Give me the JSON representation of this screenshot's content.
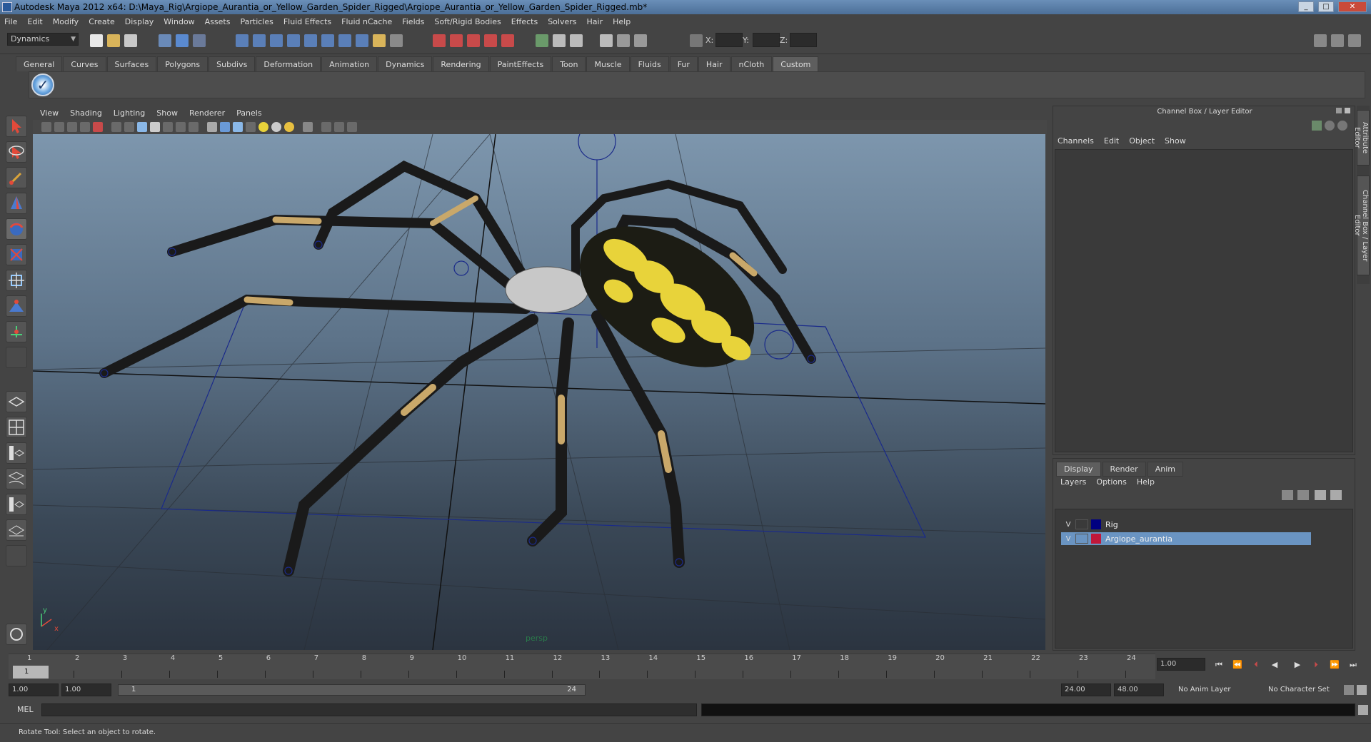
{
  "window": {
    "title": "Autodesk Maya 2012 x64: D:\\Maya_Rig\\Argiope_Aurantia_or_Yellow_Garden_Spider_Rigged\\Argiope_Aurantia_or_Yellow_Garden_Spider_Rigged.mb*",
    "minimize": "_",
    "maximize": "□",
    "close": "✕"
  },
  "menubar": [
    "File",
    "Edit",
    "Modify",
    "Create",
    "Display",
    "Window",
    "Assets",
    "Particles",
    "Fluid Effects",
    "Fluid nCache",
    "Fields",
    "Soft/Rigid Bodies",
    "Effects",
    "Solvers",
    "Hair",
    "Help"
  ],
  "statusline": {
    "mode": "Dynamics",
    "x_label": "X:",
    "y_label": "Y:",
    "z_label": "Z:"
  },
  "shelf": {
    "tabs": [
      "General",
      "Curves",
      "Surfaces",
      "Polygons",
      "Subdivs",
      "Deformation",
      "Animation",
      "Dynamics",
      "Rendering",
      "PaintEffects",
      "Toon",
      "Muscle",
      "Fluids",
      "Fur",
      "Hair",
      "nCloth",
      "Custom"
    ],
    "active_tab": "Custom"
  },
  "panel": {
    "menu": [
      "View",
      "Shading",
      "Lighting",
      "Show",
      "Renderer",
      "Panels"
    ],
    "camera": "persp",
    "axis_x": "x",
    "axis_y": "y"
  },
  "channel_box": {
    "title": "Channel Box / Layer Editor",
    "menu": [
      "Channels",
      "Edit",
      "Object",
      "Show"
    ]
  },
  "side_tabs": [
    "Attribute Editor",
    "Channel Box / Layer Editor"
  ],
  "layer_editor": {
    "tabs": [
      "Display",
      "Render",
      "Anim"
    ],
    "active_tab": "Display",
    "menu": [
      "Layers",
      "Options",
      "Help"
    ],
    "layers": [
      {
        "visible": "V",
        "name": "Rig",
        "color": "#000080",
        "selected": false
      },
      {
        "visible": "V",
        "name": "Argiope_aurantia",
        "color": "#c0183a",
        "selected": true
      }
    ]
  },
  "timeline": {
    "ticks": [
      "1",
      "2",
      "3",
      "4",
      "5",
      "6",
      "7",
      "8",
      "9",
      "10",
      "11",
      "12",
      "13",
      "14",
      "15",
      "16",
      "17",
      "18",
      "19",
      "20",
      "21",
      "22",
      "23",
      "24"
    ],
    "current_frame": "1",
    "current_frame_field": "1.00"
  },
  "range": {
    "start_time": "1.00",
    "playback_start": "1.00",
    "bar_start": "1",
    "bar_end": "24",
    "playback_end": "24.00",
    "end_time": "48.00",
    "anim_layer": "No Anim Layer",
    "character_set": "No Character Set"
  },
  "command_line": {
    "label": "MEL"
  },
  "help_line": "Rotate Tool: Select an object to rotate.",
  "colors": {
    "spider_abdomen": "#e8d33a",
    "spider_legs": "#1a1a1a",
    "leg_bands": "#c9a86a",
    "rig_lines": "#1a2a8a",
    "selected_layer": "#6a94c2"
  }
}
